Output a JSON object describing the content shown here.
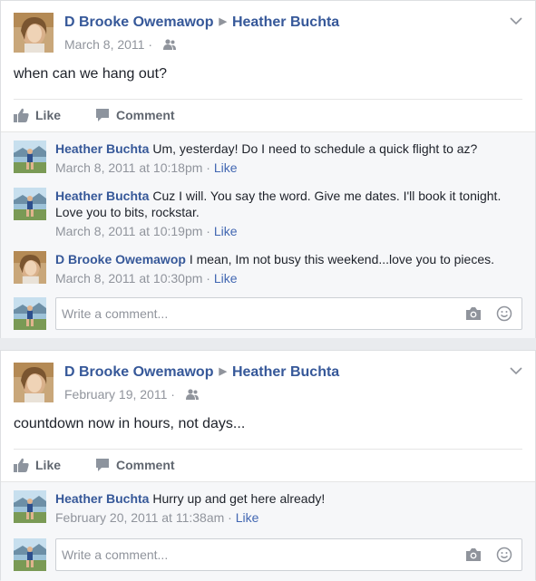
{
  "posts": [
    {
      "author": "D Brooke Owemawop",
      "recipient": "Heather Buchta",
      "date": "March 8, 2011",
      "text": "when can we hang out?",
      "actions": {
        "like": "Like",
        "comment": "Comment"
      },
      "comments": [
        {
          "author": "Heather Buchta",
          "text": "Um, yesterday! Do I need to schedule a quick flight to az?",
          "time": "March 8, 2011 at 10:18pm",
          "like": "Like"
        },
        {
          "author": "Heather Buchta",
          "text": "Cuz I will. You say the word. Give me dates. I'll book it tonight. Love you to bits, rockstar.",
          "time": "March 8, 2011 at 10:19pm",
          "like": "Like"
        },
        {
          "author": "D Brooke Owemawop",
          "text": "I mean, Im not busy this weekend...love you to pieces.",
          "time": "March 8, 2011 at 10:30pm",
          "like": "Like"
        }
      ],
      "write_placeholder": "Write a comment..."
    },
    {
      "author": "D Brooke Owemawop",
      "recipient": "Heather Buchta",
      "date": "February 19, 2011",
      "text": "countdown now in hours, not days...",
      "actions": {
        "like": "Like",
        "comment": "Comment"
      },
      "comments": [
        {
          "author": "Heather Buchta",
          "text": "Hurry up and get here already!",
          "time": "February 20, 2011 at 11:38am",
          "like": "Like"
        }
      ],
      "write_placeholder": "Write a comment..."
    }
  ],
  "meta_separator": " · ",
  "icons": {
    "chevron": "chevron-down-icon",
    "audience": "friends-audience-icon",
    "like": "thumbs-up-icon",
    "comment": "comment-bubble-icon",
    "camera": "camera-icon",
    "emoji": "emoji-smile-icon"
  },
  "colors": {
    "link": "#365899",
    "meta": "#90949c",
    "like_link": "#4267b2",
    "background": "#e9ebee"
  }
}
